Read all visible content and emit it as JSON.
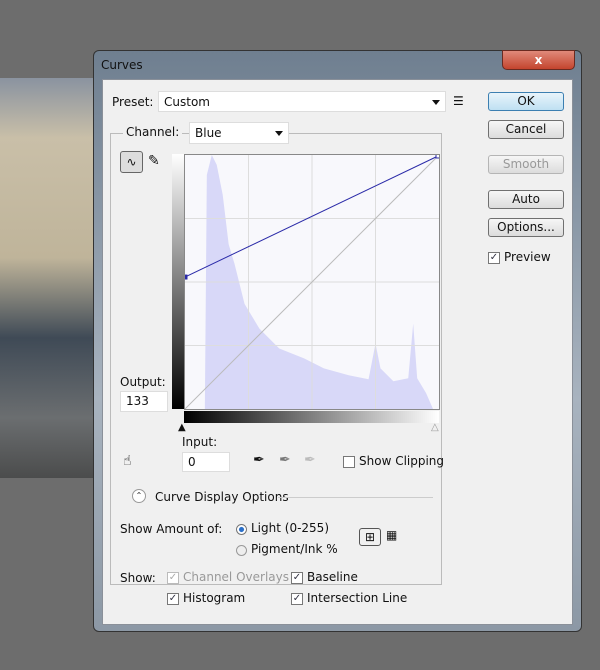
{
  "window": {
    "title": "Curves",
    "close": "x"
  },
  "preset": {
    "label": "Preset:",
    "value": "Custom"
  },
  "channel": {
    "label": "Channel:",
    "value": "Blue"
  },
  "buttons": {
    "ok": "OK",
    "cancel": "Cancel",
    "smooth": "Smooth",
    "auto": "Auto",
    "options": "Options..."
  },
  "preview": {
    "label": "Preview",
    "checked": true
  },
  "output": {
    "label": "Output:",
    "value": "133"
  },
  "input": {
    "label": "Input:",
    "value": "0"
  },
  "show_clipping": {
    "label": "Show Clipping",
    "checked": false
  },
  "curve_display_options": "Curve Display Options",
  "show_amount": {
    "label": "Show Amount of:",
    "light": "Light  (0-255)",
    "pigment": "Pigment/Ink %",
    "selected": "light"
  },
  "show": {
    "label": "Show:",
    "channel_overlays": "Channel Overlays",
    "baseline": "Baseline",
    "histogram": "Histogram",
    "intersection_line": "Intersection Line",
    "checked": {
      "channel_overlays": true,
      "baseline": true,
      "histogram": true,
      "intersection_line": true
    }
  },
  "curve": {
    "points": [
      [
        0,
        133
      ],
      [
        255,
        255
      ]
    ],
    "color": "#2a2aa8"
  },
  "colors": {
    "histogram": "#d8d8f8",
    "accent": "#3c7fb1"
  }
}
